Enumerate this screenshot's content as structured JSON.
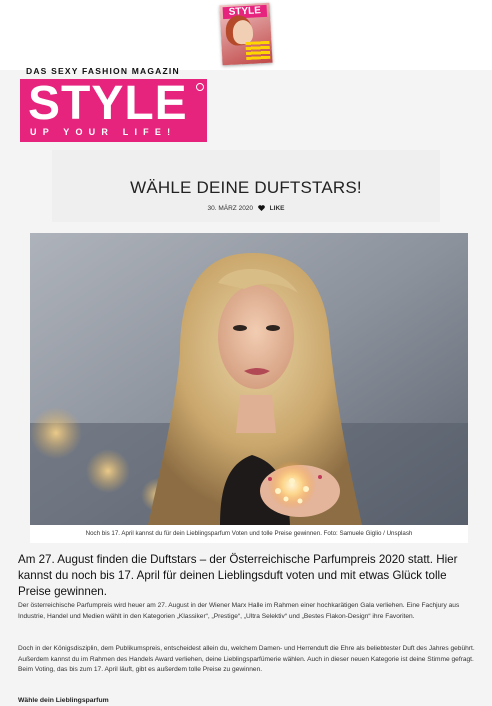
{
  "magazine_thumb": {
    "label": "STYLE",
    "alt": "Magazin-Cover"
  },
  "brand": {
    "tagline": "DAS SEXY FASHION MAGAZIN",
    "logo": "STYLE",
    "logo_sub": "UP YOUR LIFE!",
    "color": "#e6247e"
  },
  "article": {
    "title": "WÄHLE DEINE DUFTSTARS!",
    "date": "30. MÄRZ 2020",
    "like_label": "LIKE",
    "image_caption": "Noch bis 17. April kannst du für dein Lieblingsparfum Voten und tolle Preise gewinnen. Foto: Samuele Giglio / Unsplash",
    "lead": "Am 27. August finden die Duftstars – der Österreichische Parfumpreis 2020 statt. Hier kannst du noch bis 17. April für deinen Lieblingsduft voten und mit etwas Glück tolle Preise gewinnen.",
    "paragraphs": [
      "Der österreichische Parfumpreis wird heuer am 27. August in der Wiener Marx Halle im Rahmen einer hochkarätigen Gala verliehen. Eine Fachjury aus Industrie, Handel und Medien wählt in den Kategorien „Klassiker“, „Prestige“, „Ultra Selektiv“ und „Bestes Flakon-Design“ ihre Favoriten.",
      "Doch in der Königsdisziplin, dem Publikumspreis, entscheidest allein du, welchem Damen- und Herrenduft die Ehre als beliebtester Duft des Jahres gebührt. Außerdem kannst du im Rahmen des Handels Award verliehen, deine Lieblingsparfümerie wählen. Auch in dieser neuen Kategorie ist deine Stimme gefragt. Beim Voting, das bis zum 17. April läuft, gibt es außerdem tolle Preise zu gewinnen."
    ],
    "subhead": "Wähle dein Lieblingsparfum"
  },
  "icons": {
    "heart": "heart-icon"
  }
}
